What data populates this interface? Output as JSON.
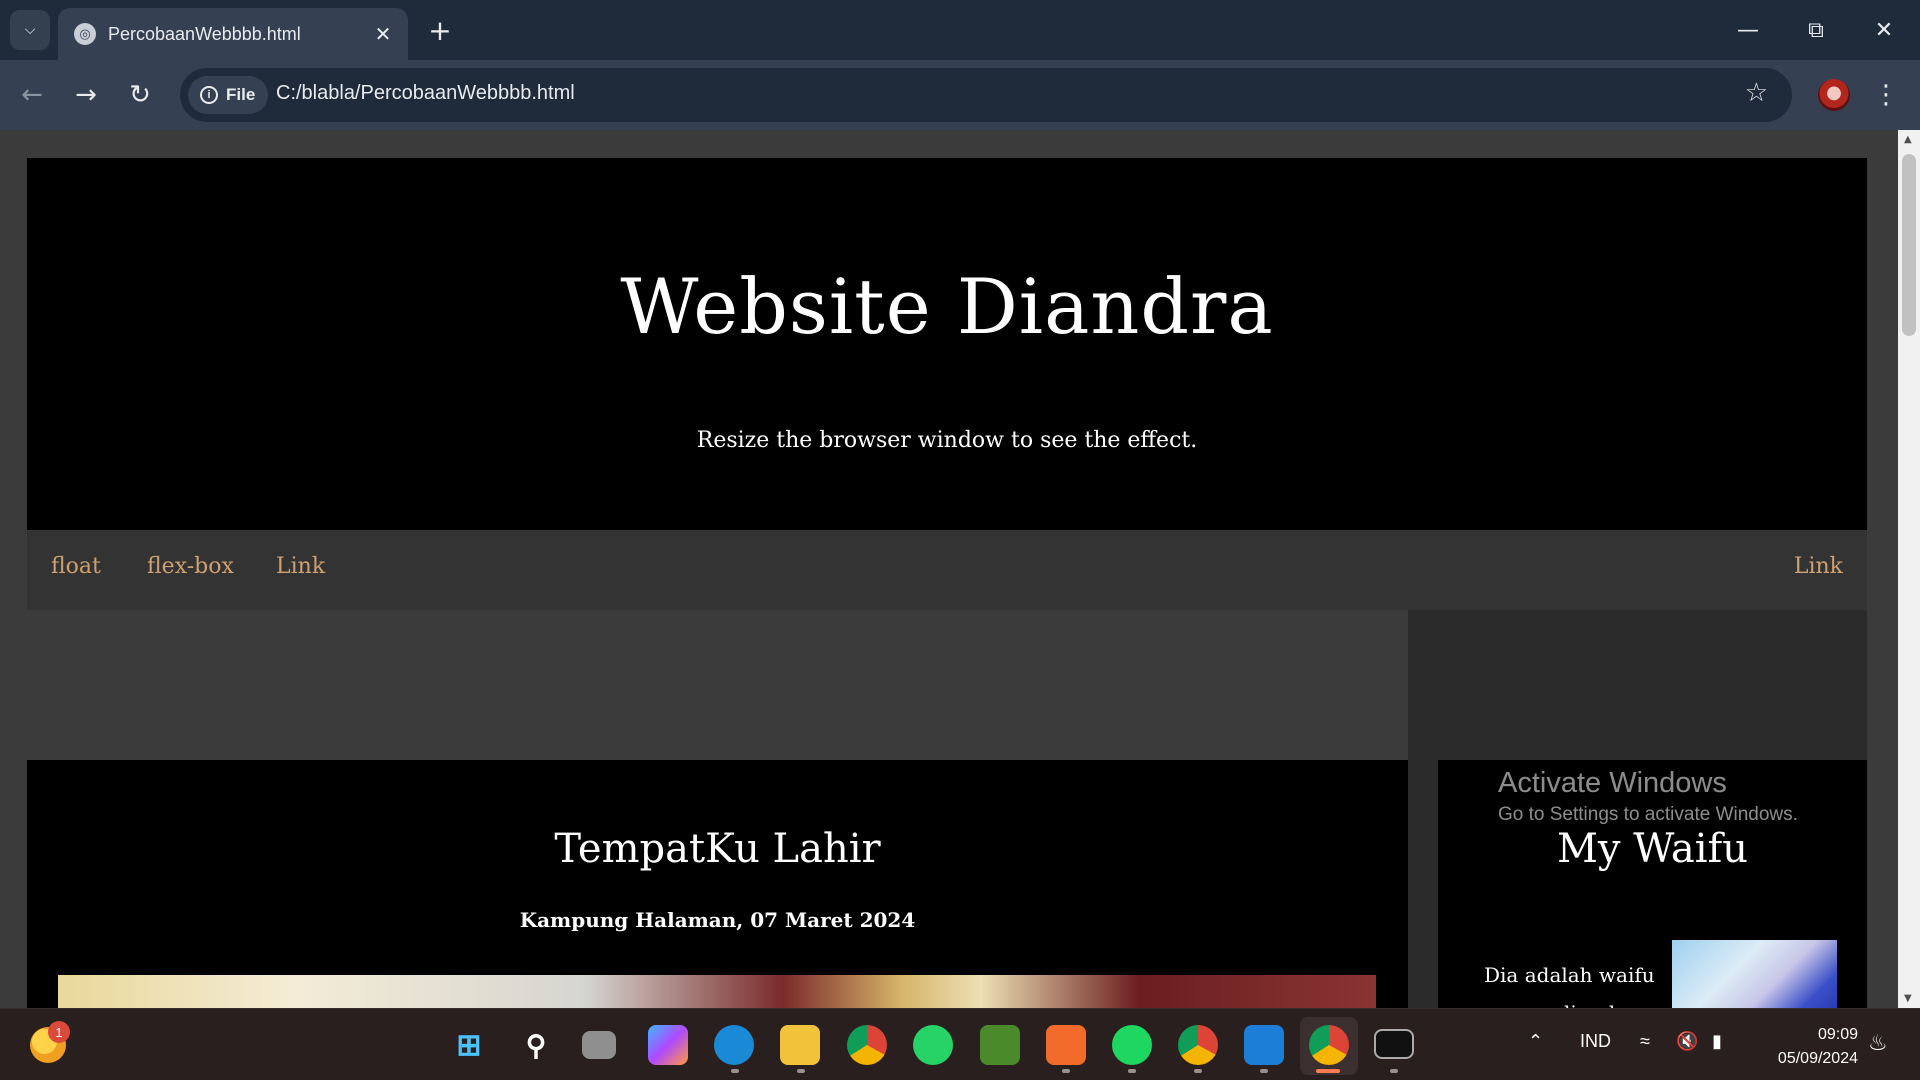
{
  "browser": {
    "tab_title": "PercobaanWebbbb.html",
    "site_chip": "File",
    "url": "C:/blabla/PercobaanWebbbb.html"
  },
  "page": {
    "header_title": "Website Diandra",
    "header_subtitle": "Resize the browser window to see the effect.",
    "nav": [
      "float",
      "flex-box",
      "Link",
      "Link"
    ],
    "nav_color": "#d0a070",
    "left_card": {
      "title": "TempatKu Lahir",
      "subtitle": "Kampung Halaman, 07 Maret 2024"
    },
    "right_card": {
      "title": "My Waifu",
      "text": "Dia adalah waifu yang paling ku"
    }
  },
  "watermark": {
    "line1": "Activate Windows",
    "line2": "Go to Settings to activate Windows."
  },
  "taskbar": {
    "weather_badge": "1",
    "language": "IND",
    "time": "09:09",
    "date": "05/09/2024"
  }
}
